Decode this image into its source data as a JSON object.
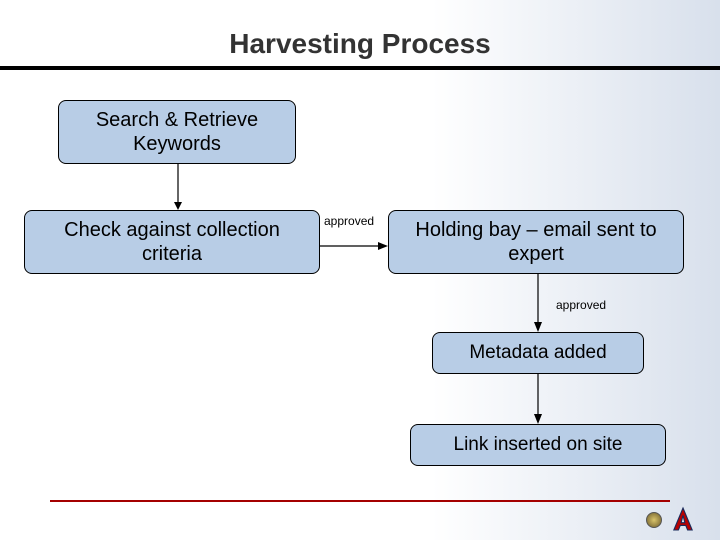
{
  "title": "Harvesting Process",
  "boxes": {
    "search": "Search & Retrieve Keywords",
    "check": "Check against collection criteria",
    "holding": "Holding bay – email sent to expert",
    "metadata": "Metadata added",
    "link": "Link inserted on site"
  },
  "edge_labels": {
    "check_to_holding": "approved",
    "holding_to_metadata": "approved"
  },
  "chart_data": {
    "type": "flowchart",
    "title": "Harvesting Process",
    "nodes": [
      {
        "id": "search",
        "label": "Search & Retrieve Keywords"
      },
      {
        "id": "check",
        "label": "Check against collection criteria"
      },
      {
        "id": "holding",
        "label": "Holding bay – email sent to expert"
      },
      {
        "id": "metadata",
        "label": "Metadata added"
      },
      {
        "id": "link",
        "label": "Link inserted on site"
      }
    ],
    "edges": [
      {
        "from": "search",
        "to": "check",
        "label": ""
      },
      {
        "from": "check",
        "to": "holding",
        "label": "approved"
      },
      {
        "from": "holding",
        "to": "metadata",
        "label": "approved"
      },
      {
        "from": "metadata",
        "to": "link",
        "label": ""
      }
    ]
  },
  "colors": {
    "node_fill": "#b8cde6",
    "node_stroke": "#000000",
    "footer_rule": "#a40000"
  }
}
